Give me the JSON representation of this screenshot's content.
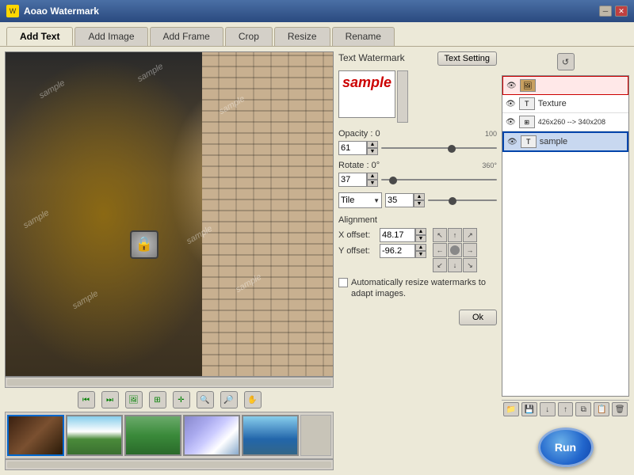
{
  "window": {
    "title": "Aoao Watermark",
    "minimize_label": "─",
    "close_label": "✕"
  },
  "tabs": [
    {
      "id": "add-text",
      "label": "Add Text",
      "active": true
    },
    {
      "id": "add-image",
      "label": "Add Image",
      "active": false
    },
    {
      "id": "add-frame",
      "label": "Add Frame",
      "active": false
    },
    {
      "id": "crop",
      "label": "Crop",
      "active": false
    },
    {
      "id": "resize",
      "label": "Resize",
      "active": false
    },
    {
      "id": "rename",
      "label": "Rename",
      "active": false
    }
  ],
  "text_watermark": {
    "section_label": "Text Watermark",
    "text_setting_btn": "Text Setting",
    "preview_text": "sample",
    "opacity_label": "Opacity : 0",
    "opacity_max": "100",
    "opacity_value": "61",
    "rotate_label": "Rotate : 0°",
    "rotate_max": "360°",
    "rotate_value": "37",
    "tile_label": "Tile",
    "tile_value": "35",
    "alignment_label": "Alignment",
    "x_offset_label": "X offset:",
    "x_offset_value": "48.17",
    "y_offset_label": "Y offset:",
    "y_offset_value": "-96.2",
    "auto_resize_label": "Automatically resize watermarks to adapt images.",
    "ok_btn": "Ok"
  },
  "layers": [
    {
      "id": "layer-1",
      "eye": "👁",
      "icon": "🖼",
      "label": "",
      "type": "image",
      "highlighted": true,
      "selected": false
    },
    {
      "id": "layer-2",
      "eye": "👁",
      "icon": "T",
      "label": "Texture",
      "type": "texture",
      "highlighted": false,
      "selected": false
    },
    {
      "id": "layer-3",
      "eye": "👁",
      "icon": "⊞",
      "label": "426x260 --> 340x208",
      "type": "resize",
      "highlighted": false,
      "selected": false
    },
    {
      "id": "layer-4",
      "eye": "👁",
      "icon": "T",
      "label": "sample",
      "type": "text",
      "highlighted": false,
      "selected": true
    }
  ],
  "panel_toolbar": {
    "refresh_icon": "↺",
    "icons": [
      "↺"
    ]
  },
  "bottom_toolbar": {
    "folder_icon": "📁",
    "save_icon": "💾",
    "down_icon": "↓",
    "up_icon": "↑",
    "copy_icon": "⧉",
    "paste_icon": "📋",
    "delete_icon": "🗑"
  },
  "nav_controls": {
    "first_icon": "⏮",
    "prev_icon": "⏪",
    "img_icon": "🖼",
    "crop_icon": "⊞",
    "move_icon": "✛",
    "zoom_in_icon": "🔍",
    "zoom_out_icon": "🔎",
    "hand_icon": "✋"
  },
  "run_button": {
    "label": "Run"
  },
  "thumbnails": [
    {
      "id": "thumb-1",
      "active": true,
      "class": "thumb-1"
    },
    {
      "id": "thumb-2",
      "active": false,
      "class": "thumb-2"
    },
    {
      "id": "thumb-3",
      "active": false,
      "class": "thumb-3"
    },
    {
      "id": "thumb-4",
      "active": false,
      "class": "thumb-4"
    },
    {
      "id": "thumb-5",
      "active": false,
      "class": "thumb-5"
    }
  ]
}
